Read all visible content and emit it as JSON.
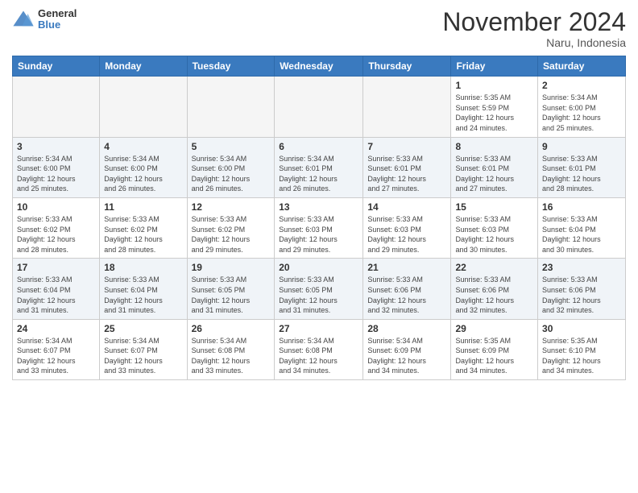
{
  "logo": {
    "general": "General",
    "blue": "Blue"
  },
  "title": {
    "month": "November 2024",
    "location": "Naru, Indonesia"
  },
  "weekdays": [
    "Sunday",
    "Monday",
    "Tuesday",
    "Wednesday",
    "Thursday",
    "Friday",
    "Saturday"
  ],
  "weeks": [
    [
      {
        "day": "",
        "info": ""
      },
      {
        "day": "",
        "info": ""
      },
      {
        "day": "",
        "info": ""
      },
      {
        "day": "",
        "info": ""
      },
      {
        "day": "",
        "info": ""
      },
      {
        "day": "1",
        "info": "Sunrise: 5:35 AM\nSunset: 5:59 PM\nDaylight: 12 hours\nand 24 minutes."
      },
      {
        "day": "2",
        "info": "Sunrise: 5:34 AM\nSunset: 6:00 PM\nDaylight: 12 hours\nand 25 minutes."
      }
    ],
    [
      {
        "day": "3",
        "info": "Sunrise: 5:34 AM\nSunset: 6:00 PM\nDaylight: 12 hours\nand 25 minutes."
      },
      {
        "day": "4",
        "info": "Sunrise: 5:34 AM\nSunset: 6:00 PM\nDaylight: 12 hours\nand 26 minutes."
      },
      {
        "day": "5",
        "info": "Sunrise: 5:34 AM\nSunset: 6:00 PM\nDaylight: 12 hours\nand 26 minutes."
      },
      {
        "day": "6",
        "info": "Sunrise: 5:34 AM\nSunset: 6:01 PM\nDaylight: 12 hours\nand 26 minutes."
      },
      {
        "day": "7",
        "info": "Sunrise: 5:33 AM\nSunset: 6:01 PM\nDaylight: 12 hours\nand 27 minutes."
      },
      {
        "day": "8",
        "info": "Sunrise: 5:33 AM\nSunset: 6:01 PM\nDaylight: 12 hours\nand 27 minutes."
      },
      {
        "day": "9",
        "info": "Sunrise: 5:33 AM\nSunset: 6:01 PM\nDaylight: 12 hours\nand 28 minutes."
      }
    ],
    [
      {
        "day": "10",
        "info": "Sunrise: 5:33 AM\nSunset: 6:02 PM\nDaylight: 12 hours\nand 28 minutes."
      },
      {
        "day": "11",
        "info": "Sunrise: 5:33 AM\nSunset: 6:02 PM\nDaylight: 12 hours\nand 28 minutes."
      },
      {
        "day": "12",
        "info": "Sunrise: 5:33 AM\nSunset: 6:02 PM\nDaylight: 12 hours\nand 29 minutes."
      },
      {
        "day": "13",
        "info": "Sunrise: 5:33 AM\nSunset: 6:03 PM\nDaylight: 12 hours\nand 29 minutes."
      },
      {
        "day": "14",
        "info": "Sunrise: 5:33 AM\nSunset: 6:03 PM\nDaylight: 12 hours\nand 29 minutes."
      },
      {
        "day": "15",
        "info": "Sunrise: 5:33 AM\nSunset: 6:03 PM\nDaylight: 12 hours\nand 30 minutes."
      },
      {
        "day": "16",
        "info": "Sunrise: 5:33 AM\nSunset: 6:04 PM\nDaylight: 12 hours\nand 30 minutes."
      }
    ],
    [
      {
        "day": "17",
        "info": "Sunrise: 5:33 AM\nSunset: 6:04 PM\nDaylight: 12 hours\nand 31 minutes."
      },
      {
        "day": "18",
        "info": "Sunrise: 5:33 AM\nSunset: 6:04 PM\nDaylight: 12 hours\nand 31 minutes."
      },
      {
        "day": "19",
        "info": "Sunrise: 5:33 AM\nSunset: 6:05 PM\nDaylight: 12 hours\nand 31 minutes."
      },
      {
        "day": "20",
        "info": "Sunrise: 5:33 AM\nSunset: 6:05 PM\nDaylight: 12 hours\nand 31 minutes."
      },
      {
        "day": "21",
        "info": "Sunrise: 5:33 AM\nSunset: 6:06 PM\nDaylight: 12 hours\nand 32 minutes."
      },
      {
        "day": "22",
        "info": "Sunrise: 5:33 AM\nSunset: 6:06 PM\nDaylight: 12 hours\nand 32 minutes."
      },
      {
        "day": "23",
        "info": "Sunrise: 5:33 AM\nSunset: 6:06 PM\nDaylight: 12 hours\nand 32 minutes."
      }
    ],
    [
      {
        "day": "24",
        "info": "Sunrise: 5:34 AM\nSunset: 6:07 PM\nDaylight: 12 hours\nand 33 minutes."
      },
      {
        "day": "25",
        "info": "Sunrise: 5:34 AM\nSunset: 6:07 PM\nDaylight: 12 hours\nand 33 minutes."
      },
      {
        "day": "26",
        "info": "Sunrise: 5:34 AM\nSunset: 6:08 PM\nDaylight: 12 hours\nand 33 minutes."
      },
      {
        "day": "27",
        "info": "Sunrise: 5:34 AM\nSunset: 6:08 PM\nDaylight: 12 hours\nand 34 minutes."
      },
      {
        "day": "28",
        "info": "Sunrise: 5:34 AM\nSunset: 6:09 PM\nDaylight: 12 hours\nand 34 minutes."
      },
      {
        "day": "29",
        "info": "Sunrise: 5:35 AM\nSunset: 6:09 PM\nDaylight: 12 hours\nand 34 minutes."
      },
      {
        "day": "30",
        "info": "Sunrise: 5:35 AM\nSunset: 6:10 PM\nDaylight: 12 hours\nand 34 minutes."
      }
    ]
  ]
}
